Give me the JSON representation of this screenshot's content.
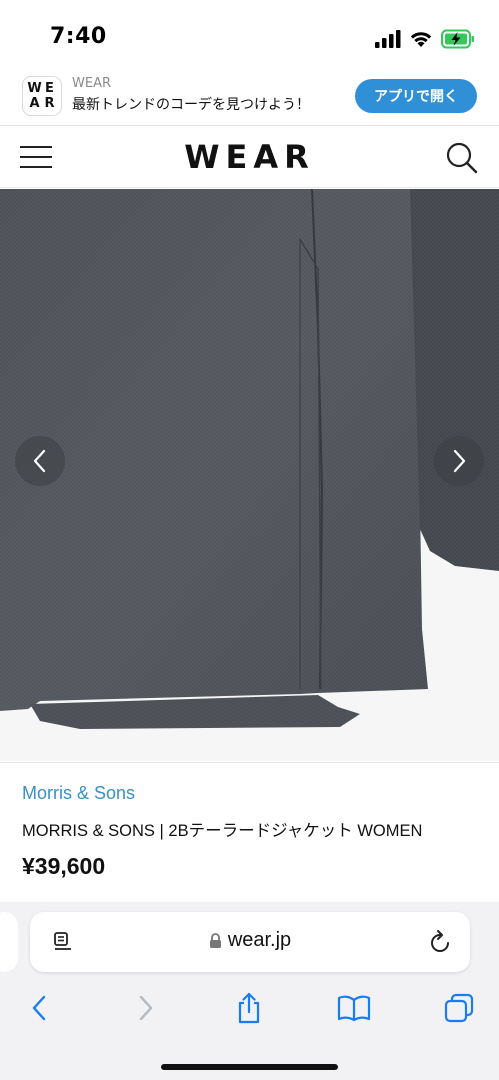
{
  "status_bar": {
    "time": "7:40"
  },
  "app_banner": {
    "logo_letters": [
      "W",
      "E",
      "A",
      "R"
    ],
    "app_name": "WEAR",
    "tagline": "最新トレンドのコーデを見つけよう！",
    "open_button": "アプリで開く",
    "accent_color": "#2f90d8"
  },
  "header": {
    "logo": "WEAR",
    "menu_icon": "hamburger-icon",
    "search_icon": "search-icon"
  },
  "product_image": {
    "subject": "gray tailored jacket hem",
    "prev_icon": "chevron-left-icon",
    "next_icon": "chevron-right-icon"
  },
  "product": {
    "brand": "Morris & Sons",
    "name": "MORRIS & SONS | 2Bテーラードジャケット WOMEN",
    "price": "¥39,600",
    "brand_color": "#3a8fc4"
  },
  "browser": {
    "url": "wear.jp",
    "toolbar_icons": [
      "back-icon",
      "forward-icon",
      "share-icon",
      "bookmarks-icon",
      "tabs-icon"
    ],
    "accent_color": "#1a7cf5"
  }
}
